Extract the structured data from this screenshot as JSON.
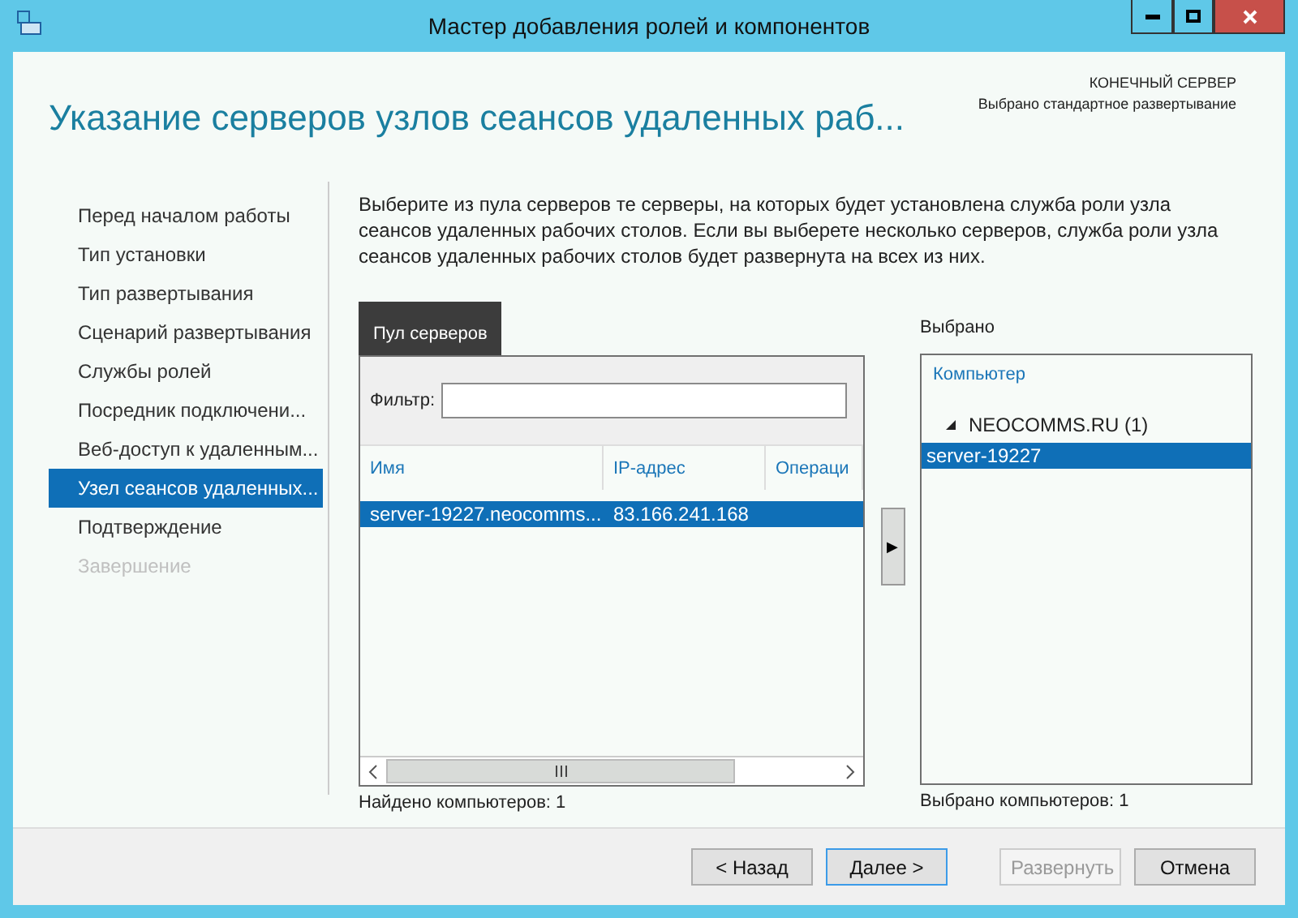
{
  "window": {
    "title": "Мастер добавления ролей и компонентов"
  },
  "header": {
    "heading": "Указание серверов узлов сеансов удаленных раб...",
    "server_label": "КОНЕЧНЫЙ СЕРВЕР",
    "server_value": "Выбрано стандартное развертывание"
  },
  "steps": [
    {
      "label": "Перед началом работы",
      "selected": false,
      "disabled": false
    },
    {
      "label": "Тип установки",
      "selected": false,
      "disabled": false
    },
    {
      "label": "Тип развертывания",
      "selected": false,
      "disabled": false
    },
    {
      "label": "Сценарий развертывания",
      "selected": false,
      "disabled": false
    },
    {
      "label": "Службы ролей",
      "selected": false,
      "disabled": false
    },
    {
      "label": "Посредник подключени...",
      "selected": false,
      "disabled": false
    },
    {
      "label": "Веб-доступ к удаленным...",
      "selected": false,
      "disabled": false
    },
    {
      "label": "Узел сеансов удаленных...",
      "selected": true,
      "disabled": false
    },
    {
      "label": "Подтверждение",
      "selected": false,
      "disabled": false
    },
    {
      "label": "Завершение",
      "selected": false,
      "disabled": true
    }
  ],
  "description": "Выберите из пула серверов те серверы, на которых будет установлена служба роли узла сеансов удаленных рабочих столов. Если вы выберете несколько серверов, служба роли узла сеансов удаленных рабочих столов будет развернута на всех из них.",
  "pool": {
    "tab": "Пул серверов",
    "filter_label": "Фильтр:",
    "columns": [
      "Имя",
      "IP-адрес",
      "Операци"
    ],
    "rows": [
      {
        "cells": [
          "server-19227.neocomms...",
          "83.166.241.168"
        ],
        "selected": true
      }
    ],
    "count": "Найдено компьютеров: 1"
  },
  "add_button": "▶",
  "selected_panel": {
    "label": "Выбрано",
    "column": "Компьютер",
    "groups": [
      {
        "name": "NEOCOMMS.RU (1)",
        "expanded": true,
        "children": [
          {
            "name": "server-19227",
            "selected": true
          }
        ]
      }
    ],
    "count": "Выбрано компьютеров: 1"
  },
  "buttons": [
    {
      "label": "< Назад",
      "disabled": false,
      "focused": false
    },
    {
      "label": "Далее >",
      "disabled": false,
      "focused": true
    },
    {
      "label": "Развернуть",
      "disabled": true,
      "focused": false
    },
    {
      "label": "Отмена",
      "disabled": false,
      "focused": false
    }
  ]
}
